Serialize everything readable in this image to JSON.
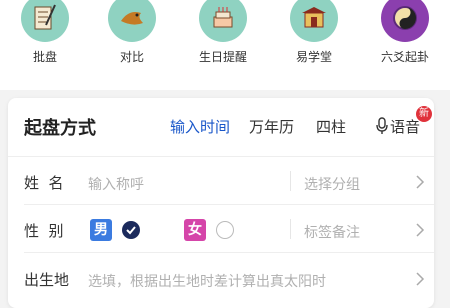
{
  "quick_actions": [
    {
      "label": "批盘",
      "icon": "scroll-brush-icon",
      "color": "#8fd2c1"
    },
    {
      "label": "对比",
      "icon": "koi-fish-icon",
      "color": "#8fd2c1"
    },
    {
      "label": "生日提醒",
      "icon": "birthday-cake-icon",
      "color": "#8fd2c1"
    },
    {
      "label": "易学堂",
      "icon": "temple-icon",
      "color": "#8fd2c1"
    },
    {
      "label": "六爻起卦",
      "icon": "bagua-icon",
      "color": "#8b3fae"
    }
  ],
  "card": {
    "title": "起盘方式",
    "tabs": [
      "输入时间",
      "万年历",
      "四柱",
      "语音"
    ],
    "badge": "新"
  },
  "form": {
    "name_label": "姓  名",
    "name_placeholder": "输入称呼",
    "group_placeholder": "选择分组",
    "gender_label": "性  别",
    "male": "男",
    "female": "女",
    "tag_placeholder": "标签备注",
    "birthplace_label": "出生地",
    "birthplace_placeholder": "选填，根据出生地时差计算出真太阳时"
  },
  "colors": {
    "accent": "#1a57c9",
    "male": "#3b7be0",
    "female": "#d545a9",
    "badge": "#e0323b"
  }
}
